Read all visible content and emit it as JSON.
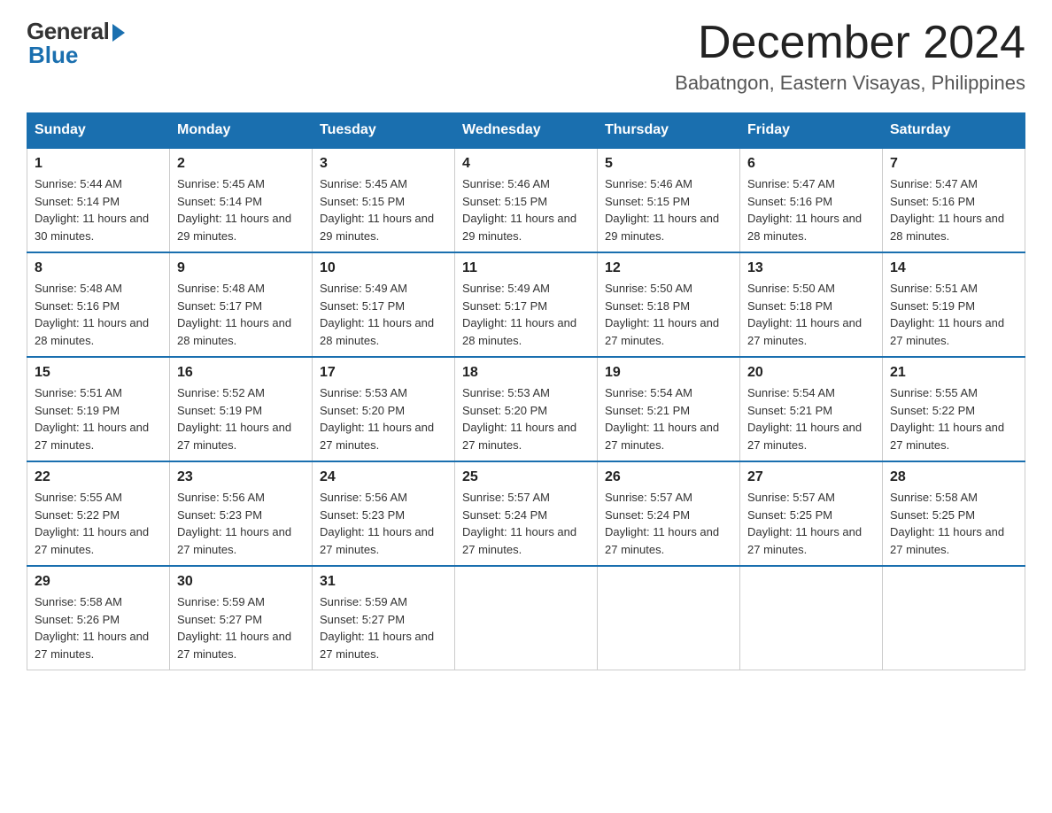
{
  "logo": {
    "general": "General",
    "blue": "Blue"
  },
  "header": {
    "month_year": "December 2024",
    "location": "Babatngon, Eastern Visayas, Philippines"
  },
  "days_of_week": [
    "Sunday",
    "Monday",
    "Tuesday",
    "Wednesday",
    "Thursday",
    "Friday",
    "Saturday"
  ],
  "weeks": [
    [
      {
        "day": "1",
        "sunrise": "5:44 AM",
        "sunset": "5:14 PM",
        "daylight": "11 hours and 30 minutes."
      },
      {
        "day": "2",
        "sunrise": "5:45 AM",
        "sunset": "5:14 PM",
        "daylight": "11 hours and 29 minutes."
      },
      {
        "day": "3",
        "sunrise": "5:45 AM",
        "sunset": "5:15 PM",
        "daylight": "11 hours and 29 minutes."
      },
      {
        "day": "4",
        "sunrise": "5:46 AM",
        "sunset": "5:15 PM",
        "daylight": "11 hours and 29 minutes."
      },
      {
        "day": "5",
        "sunrise": "5:46 AM",
        "sunset": "5:15 PM",
        "daylight": "11 hours and 29 minutes."
      },
      {
        "day": "6",
        "sunrise": "5:47 AM",
        "sunset": "5:16 PM",
        "daylight": "11 hours and 28 minutes."
      },
      {
        "day": "7",
        "sunrise": "5:47 AM",
        "sunset": "5:16 PM",
        "daylight": "11 hours and 28 minutes."
      }
    ],
    [
      {
        "day": "8",
        "sunrise": "5:48 AM",
        "sunset": "5:16 PM",
        "daylight": "11 hours and 28 minutes."
      },
      {
        "day": "9",
        "sunrise": "5:48 AM",
        "sunset": "5:17 PM",
        "daylight": "11 hours and 28 minutes."
      },
      {
        "day": "10",
        "sunrise": "5:49 AM",
        "sunset": "5:17 PM",
        "daylight": "11 hours and 28 minutes."
      },
      {
        "day": "11",
        "sunrise": "5:49 AM",
        "sunset": "5:17 PM",
        "daylight": "11 hours and 28 minutes."
      },
      {
        "day": "12",
        "sunrise": "5:50 AM",
        "sunset": "5:18 PM",
        "daylight": "11 hours and 27 minutes."
      },
      {
        "day": "13",
        "sunrise": "5:50 AM",
        "sunset": "5:18 PM",
        "daylight": "11 hours and 27 minutes."
      },
      {
        "day": "14",
        "sunrise": "5:51 AM",
        "sunset": "5:19 PM",
        "daylight": "11 hours and 27 minutes."
      }
    ],
    [
      {
        "day": "15",
        "sunrise": "5:51 AM",
        "sunset": "5:19 PM",
        "daylight": "11 hours and 27 minutes."
      },
      {
        "day": "16",
        "sunrise": "5:52 AM",
        "sunset": "5:19 PM",
        "daylight": "11 hours and 27 minutes."
      },
      {
        "day": "17",
        "sunrise": "5:53 AM",
        "sunset": "5:20 PM",
        "daylight": "11 hours and 27 minutes."
      },
      {
        "day": "18",
        "sunrise": "5:53 AM",
        "sunset": "5:20 PM",
        "daylight": "11 hours and 27 minutes."
      },
      {
        "day": "19",
        "sunrise": "5:54 AM",
        "sunset": "5:21 PM",
        "daylight": "11 hours and 27 minutes."
      },
      {
        "day": "20",
        "sunrise": "5:54 AM",
        "sunset": "5:21 PM",
        "daylight": "11 hours and 27 minutes."
      },
      {
        "day": "21",
        "sunrise": "5:55 AM",
        "sunset": "5:22 PM",
        "daylight": "11 hours and 27 minutes."
      }
    ],
    [
      {
        "day": "22",
        "sunrise": "5:55 AM",
        "sunset": "5:22 PM",
        "daylight": "11 hours and 27 minutes."
      },
      {
        "day": "23",
        "sunrise": "5:56 AM",
        "sunset": "5:23 PM",
        "daylight": "11 hours and 27 minutes."
      },
      {
        "day": "24",
        "sunrise": "5:56 AM",
        "sunset": "5:23 PM",
        "daylight": "11 hours and 27 minutes."
      },
      {
        "day": "25",
        "sunrise": "5:57 AM",
        "sunset": "5:24 PM",
        "daylight": "11 hours and 27 minutes."
      },
      {
        "day": "26",
        "sunrise": "5:57 AM",
        "sunset": "5:24 PM",
        "daylight": "11 hours and 27 minutes."
      },
      {
        "day": "27",
        "sunrise": "5:57 AM",
        "sunset": "5:25 PM",
        "daylight": "11 hours and 27 minutes."
      },
      {
        "day": "28",
        "sunrise": "5:58 AM",
        "sunset": "5:25 PM",
        "daylight": "11 hours and 27 minutes."
      }
    ],
    [
      {
        "day": "29",
        "sunrise": "5:58 AM",
        "sunset": "5:26 PM",
        "daylight": "11 hours and 27 minutes."
      },
      {
        "day": "30",
        "sunrise": "5:59 AM",
        "sunset": "5:27 PM",
        "daylight": "11 hours and 27 minutes."
      },
      {
        "day": "31",
        "sunrise": "5:59 AM",
        "sunset": "5:27 PM",
        "daylight": "11 hours and 27 minutes."
      },
      null,
      null,
      null,
      null
    ]
  ]
}
